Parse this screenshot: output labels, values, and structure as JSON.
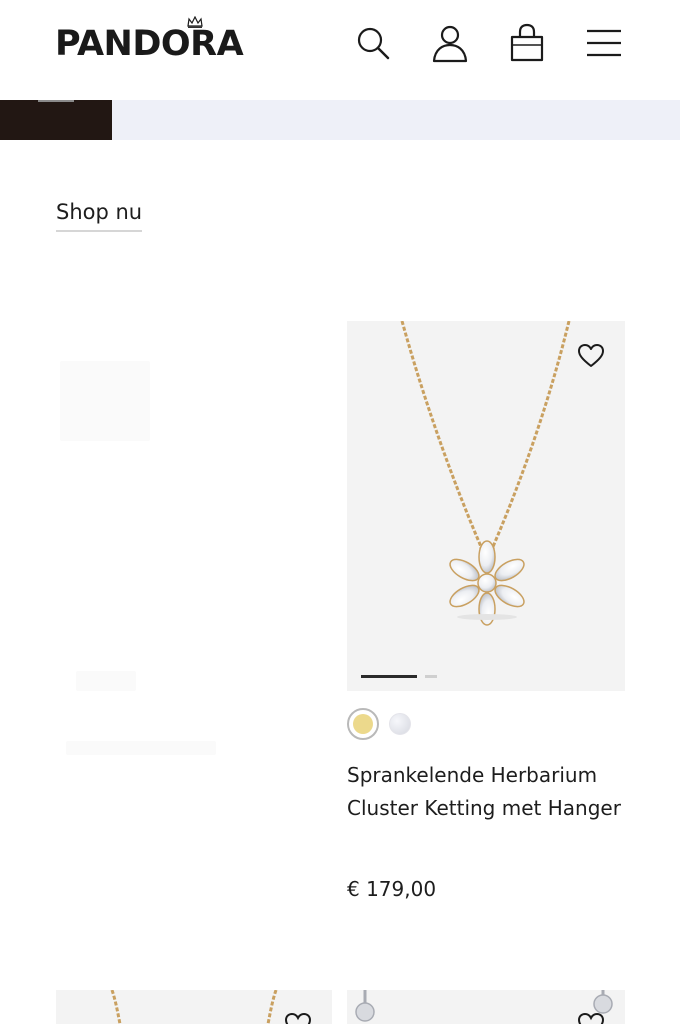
{
  "header": {
    "logo_text": "PANDORA",
    "icons": [
      "search-icon",
      "account-icon",
      "shopping-bag-icon",
      "menu-icon"
    ]
  },
  "shop_link": "Shop nu",
  "product": {
    "name": "Sprankelende Herbarium Cluster Ketting met Hanger",
    "price": "€ 179,00",
    "swatches": [
      {
        "name": "gold",
        "color": "#ecd98c",
        "selected": true
      },
      {
        "name": "silver",
        "color": "#d6d8e0",
        "selected": false
      }
    ]
  },
  "colors": {
    "text": "#1b1b1b",
    "banner_dark": "#221713",
    "banner_light": "#eef0f8",
    "card_bg": "#f3f3f3",
    "gold_chain": "#c9a060"
  }
}
